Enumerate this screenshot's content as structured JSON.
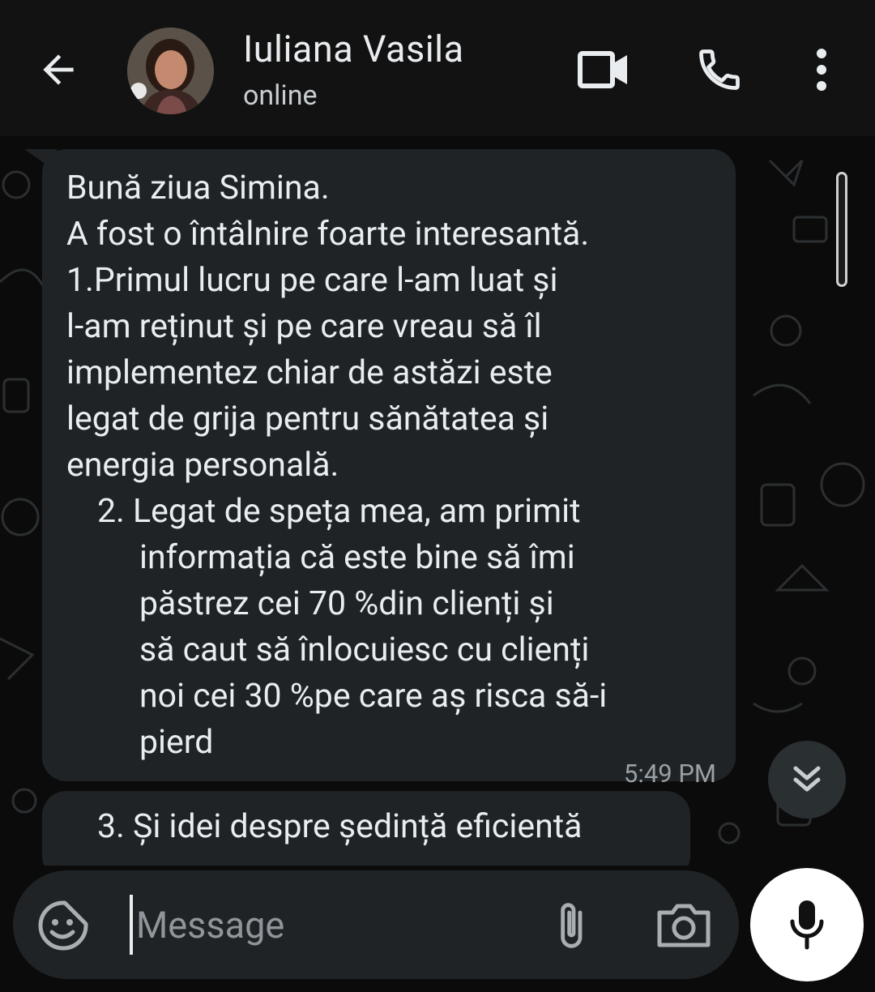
{
  "header": {
    "title": "Iuliana Vasila",
    "status": "online"
  },
  "messages": [
    {
      "lines": [
        "Bună ziua Simina.",
        "A fost o întâlnire foarte interesantă.",
        "1.Primul lucru pe care l-am luat și",
        "l-am reținut și pe care vreau să îl",
        "implementez chiar de astăzi este",
        "legat de grija pentru sănătatea și",
        "energia personală.",
        "2. Legat de speța mea, am primit",
        "informația că este bine să îmi",
        "păstrez cei 70 %din clienți și",
        "să caut să înlocuiesc cu clienți",
        "noi cei 30 %pe care aș risca să-i",
        "pierd"
      ],
      "time": "5:49 PM"
    },
    {
      "lines": [
        "3. Și idei despre ședință eficientă"
      ]
    }
  ],
  "composer": {
    "placeholder": "Message"
  },
  "icons": {
    "back": "arrow-left-icon",
    "video": "video-camera-icon",
    "call": "phone-icon",
    "menu": "more-vertical-icon",
    "emoji": "sticker-emoji-icon",
    "attach": "paperclip-icon",
    "camera": "camera-icon",
    "mic": "microphone-icon",
    "scroll": "double-chevron-down-icon"
  },
  "colors": {
    "header_bg": "#121212",
    "chat_bg": "#0b0b0b",
    "bubble_bg": "#202325",
    "text": "#e9edef",
    "muted": "#9aa0a5",
    "mic_bg": "#ffffff"
  }
}
